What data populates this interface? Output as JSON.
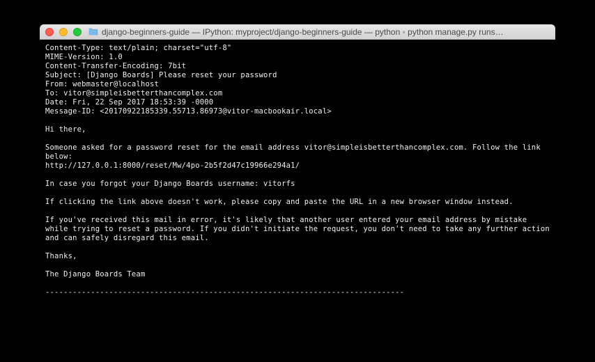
{
  "window": {
    "title": "django-beginners-guide — IPython: myproject/django-beginners-guide — python ◦ python manage.py runs…"
  },
  "email": {
    "headers": {
      "content_type": "Content-Type: text/plain; charset=\"utf-8\"",
      "mime_version": "MIME-Version: 1.0",
      "content_transfer_encoding": "Content-Transfer-Encoding: 7bit",
      "subject": "Subject: [Django Boards] Please reset your password",
      "from": "From: webmaster@localhost",
      "to": "To: vitor@simpleisbetterthancomplex.com",
      "date": "Date: Fri, 22 Sep 2017 18:53:39 -0000",
      "message_id": "Message-ID: <20170922185339.55713.86973@vitor-macbookair.local>"
    },
    "body": {
      "greeting": "Hi there,",
      "intro": "Someone asked for a password reset for the email address vitor@simpleisbetterthancomplex.com. Follow the link below:",
      "reset_link": "http://127.0.0.1:8000/reset/Mw/4po-2b5f2d47c19966e294a1/",
      "username_reminder": "In case you forgot your Django Boards username: vitorfs",
      "fallback_note": "If clicking the link above doesn't work, please copy and paste the URL in a new browser window instead.",
      "error_note": "If you've received this mail in error, it's likely that another user entered your email address by mistake while trying to reset a password. If you didn't initiate the request, you don't need to take any further action and can safely disregard this email.",
      "thanks": "Thanks,",
      "signature": "The Django Boards Team",
      "separator": "-------------------------------------------------------------------------------"
    }
  }
}
